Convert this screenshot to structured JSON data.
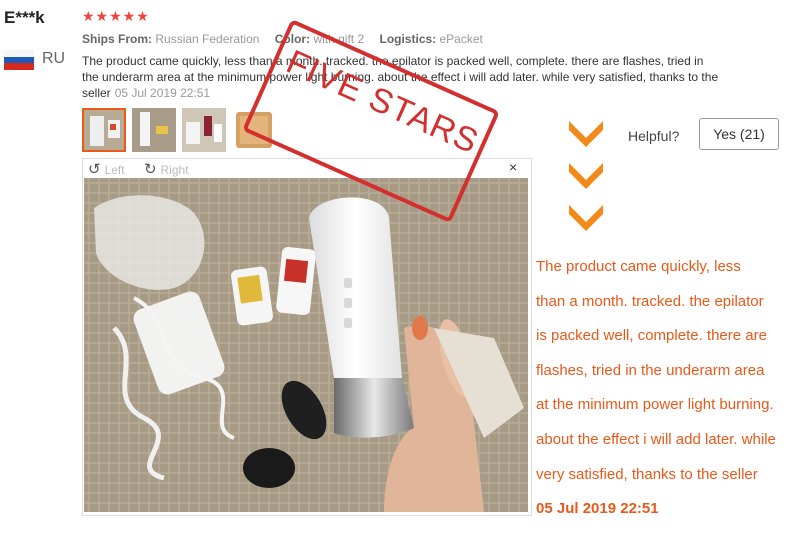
{
  "review": {
    "reviewer": "E***k",
    "country": "RU",
    "stars": "★★★★★",
    "meta": {
      "ships_from_label": "Ships From:",
      "ships_from": "Russian Federation",
      "color_label": "Color:",
      "color": "with gift 2",
      "logistics_label": "Logistics:",
      "logistics": "ePacket"
    },
    "text": "The product came quickly, less than a month. tracked. the epilator is packed well, complete. there are flashes, tried in the underarm area at the minimum power light burning. about the effect i will add later. while very satisfied, thanks to the seller",
    "date": "05 Jul 2019 22:51"
  },
  "viewer": {
    "left_label": "Left",
    "right_label": "Right",
    "close": "×"
  },
  "stamp": {
    "line1": "FIVE STARS"
  },
  "helpful": {
    "label": "Helpful?",
    "yes_button": "Yes (21)"
  },
  "callout": {
    "lines": [
      "The product came quickly, less",
      "than a month. tracked. the epilator",
      "is packed well, complete. there are",
      "flashes, tried in the underarm area",
      "at the minimum power light burning.",
      "about the effect i will add later. while",
      "very satisfied, thanks to the seller"
    ],
    "date": "05 Jul 2019 22:51"
  },
  "colors": {
    "star": "#f44336",
    "accent_orange": "#e8591a",
    "stamp_red": "#d32f2f"
  }
}
